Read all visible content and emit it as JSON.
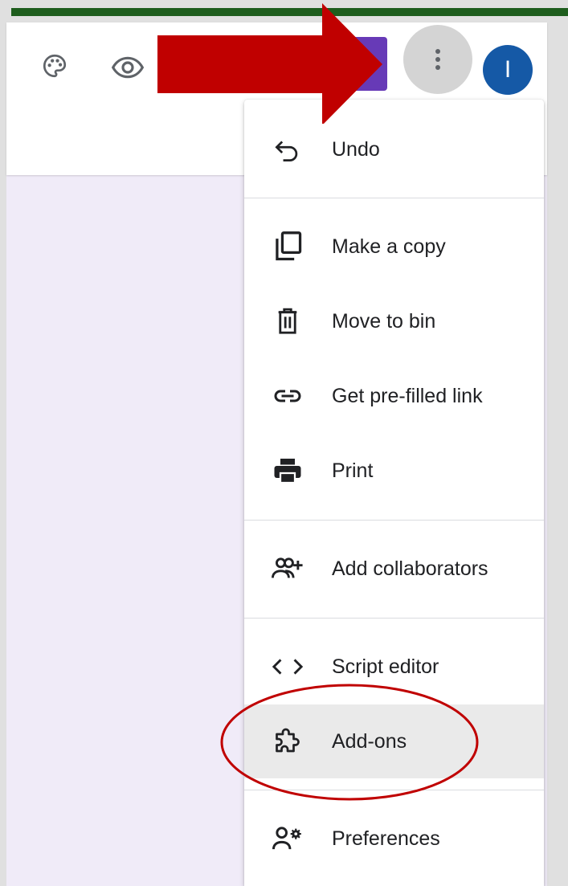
{
  "header": {
    "icons": [
      "palette-icon",
      "eye-icon",
      "more-vert-icon"
    ],
    "avatar_initial": "I",
    "accent_color": "#673ab7",
    "avatar_color": "#1559a6"
  },
  "menu": {
    "items": [
      {
        "label": "Undo",
        "icon": "undo-icon"
      },
      {
        "label": "Make a copy",
        "icon": "copy-icon"
      },
      {
        "label": "Move to bin",
        "icon": "trash-icon"
      },
      {
        "label": "Get pre-filled link",
        "icon": "link-icon"
      },
      {
        "label": "Print",
        "icon": "printer-icon"
      },
      {
        "label": "Add collaborators",
        "icon": "add-people-icon"
      },
      {
        "label": "Script editor",
        "icon": "code-icon"
      },
      {
        "label": "Add-ons",
        "icon": "puzzle-icon"
      },
      {
        "label": "Preferences",
        "icon": "person-settings-icon"
      }
    ],
    "highlighted": "Add-ons"
  },
  "annotations": {
    "arrow_color": "#c00000",
    "circle_color": "#c00000"
  }
}
